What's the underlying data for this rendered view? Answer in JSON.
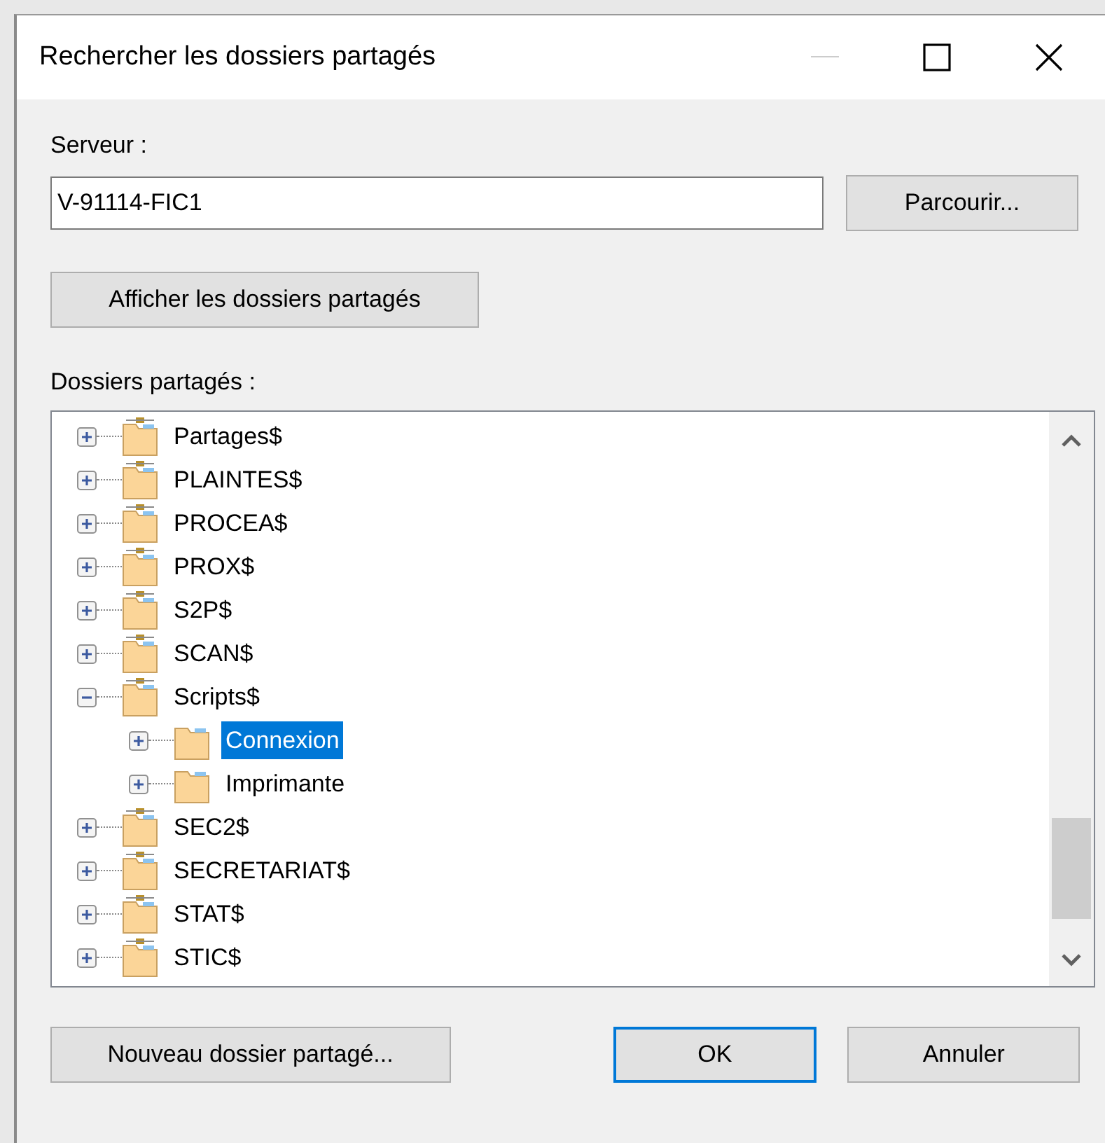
{
  "window": {
    "title": "Rechercher les dossiers partagés"
  },
  "server": {
    "label": "Serveur :",
    "value": "V-91114-FIC1",
    "browse_button": "Parcourir..."
  },
  "show_button": "Afficher les dossiers partagés",
  "tree": {
    "label": "Dossiers partagés :",
    "items": [
      {
        "label": "Partages$",
        "kind": "share",
        "expanded": false,
        "selected": false
      },
      {
        "label": "PLAINTES$",
        "kind": "share",
        "expanded": false,
        "selected": false
      },
      {
        "label": "PROCEA$",
        "kind": "share",
        "expanded": false,
        "selected": false
      },
      {
        "label": "PROX$",
        "kind": "share",
        "expanded": false,
        "selected": false
      },
      {
        "label": "S2P$",
        "kind": "share",
        "expanded": false,
        "selected": false
      },
      {
        "label": "SCAN$",
        "kind": "share",
        "expanded": false,
        "selected": false
      },
      {
        "label": "Scripts$",
        "kind": "share",
        "expanded": true,
        "selected": false,
        "children": [
          {
            "label": "Connexion",
            "kind": "folder",
            "expanded": false,
            "selected": true
          },
          {
            "label": "Imprimante",
            "kind": "folder",
            "expanded": false,
            "selected": false
          }
        ]
      },
      {
        "label": "SEC2$",
        "kind": "share",
        "expanded": false,
        "selected": false
      },
      {
        "label": "SECRETARIAT$",
        "kind": "share",
        "expanded": false,
        "selected": false
      },
      {
        "label": "STAT$",
        "kind": "share",
        "expanded": false,
        "selected": false
      },
      {
        "label": "STIC$",
        "kind": "share",
        "expanded": false,
        "selected": false
      }
    ]
  },
  "buttons": [
    {
      "label": "Nouveau dossier partagé...",
      "default": false
    },
    {
      "label": "OK",
      "default": true
    },
    {
      "label": "Annuler",
      "default": false
    }
  ]
}
